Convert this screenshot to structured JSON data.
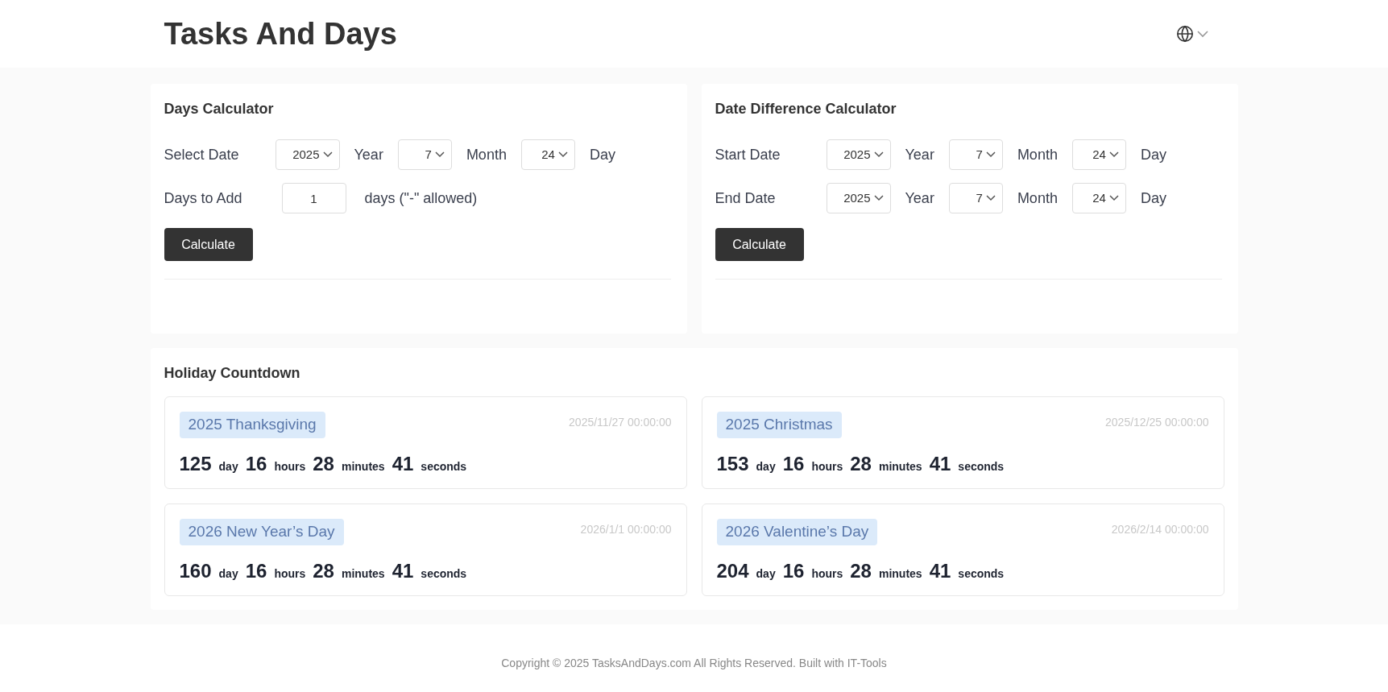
{
  "header": {
    "title": "Tasks And Days"
  },
  "calculators": [
    {
      "title": "Days Calculator",
      "rows": [
        {
          "kind": "date",
          "label": "Select Date",
          "fields": [
            {
              "value": "2025",
              "unit": "Year"
            },
            {
              "value": "7",
              "unit": "Month"
            },
            {
              "value": "24",
              "unit": "Day"
            }
          ]
        },
        {
          "kind": "number",
          "label": "Days to Add",
          "value": "1",
          "suffix": "days (\"-\" allowed)"
        }
      ],
      "button": "Calculate"
    },
    {
      "title": "Date Difference Calculator",
      "rows": [
        {
          "kind": "date",
          "label": "Start Date",
          "fields": [
            {
              "value": "2025",
              "unit": "Year"
            },
            {
              "value": "7",
              "unit": "Month"
            },
            {
              "value": "24",
              "unit": "Day"
            }
          ]
        },
        {
          "kind": "date",
          "label": "End Date",
          "fields": [
            {
              "value": "2025",
              "unit": "Year"
            },
            {
              "value": "7",
              "unit": "Month"
            },
            {
              "value": "24",
              "unit": "Day"
            }
          ]
        }
      ],
      "button": "Calculate"
    }
  ],
  "holiday_countdown": {
    "title": "Holiday Countdown",
    "holidays": [
      {
        "name": "2025 Thanksgiving",
        "date": "2025/11/27 00:00:00",
        "countdown": [
          {
            "value": "125",
            "unit": "day"
          },
          {
            "value": "16",
            "unit": "hours"
          },
          {
            "value": "28",
            "unit": "minutes"
          },
          {
            "value": "41",
            "unit": "seconds"
          }
        ]
      },
      {
        "name": "2025 Christmas",
        "date": "2025/12/25 00:00:00",
        "countdown": [
          {
            "value": "153",
            "unit": "day"
          },
          {
            "value": "16",
            "unit": "hours"
          },
          {
            "value": "28",
            "unit": "minutes"
          },
          {
            "value": "41",
            "unit": "seconds"
          }
        ]
      },
      {
        "name": "2026 New Year’s Day",
        "date": "2026/1/1 00:00:00",
        "countdown": [
          {
            "value": "160",
            "unit": "day"
          },
          {
            "value": "16",
            "unit": "hours"
          },
          {
            "value": "28",
            "unit": "minutes"
          },
          {
            "value": "41",
            "unit": "seconds"
          }
        ]
      },
      {
        "name": "2026 Valentine’s Day",
        "date": "2026/2/14 00:00:00",
        "countdown": [
          {
            "value": "204",
            "unit": "day"
          },
          {
            "value": "16",
            "unit": "hours"
          },
          {
            "value": "28",
            "unit": "minutes"
          },
          {
            "value": "41",
            "unit": "seconds"
          }
        ]
      }
    ]
  },
  "footer": {
    "text": "Copyright © 2025 TasksAndDays.com All Rights Reserved. Built with IT-Tools"
  }
}
